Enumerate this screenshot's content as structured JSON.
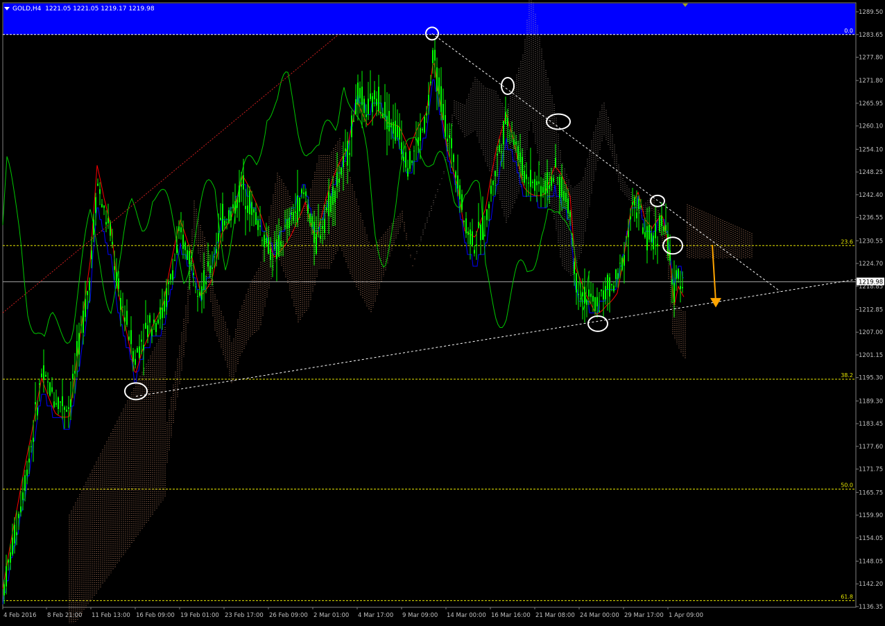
{
  "header": {
    "symbol": "GOLD,H4",
    "quote": "1221.05 1221.05 1219.17 1219.98"
  },
  "colors": {
    "background": "#000000",
    "candles": "#00ff00",
    "tenkan": "#ff0000",
    "kijun": "#0000ff",
    "chikou": "#00c800",
    "kumo": "#ffb38a",
    "fib_zone": "#0000ff",
    "fib_lines": "#e6e600",
    "trendlines": "#ffffff",
    "arrow": "#ffa500",
    "axis_text": "#c0c0c0"
  },
  "chart_data": {
    "type": "candlestick",
    "title": "",
    "price_ticks": [
      "1289.50",
      "1283.65",
      "1277.80",
      "1271.80",
      "1265.95",
      "1260.10",
      "1254.10",
      "1248.25",
      "1242.40",
      "1236.55",
      "1230.55",
      "1224.70",
      "1218.85",
      "1212.85",
      "1207.00",
      "1201.15",
      "1195.30",
      "1189.30",
      "1183.45",
      "1177.60",
      "1171.75",
      "1165.75",
      "1159.90",
      "1154.05",
      "1148.05",
      "1142.20",
      "1136.35"
    ],
    "time_ticks": [
      "4 Feb 2016",
      "8 Feb 21:00",
      "11 Feb 13:00",
      "16 Feb 09:00",
      "19 Feb 01:00",
      "23 Feb 17:00",
      "26 Feb 09:00",
      "2 Mar 01:00",
      "4 Mar 17:00",
      "9 Mar 09:00",
      "14 Mar 00:00",
      "16 Mar 16:00",
      "21 Mar 08:00",
      "24 Mar 00:00",
      "29 Mar 17:00",
      "1 Apr 09:00"
    ],
    "current_price": "1219.98",
    "ylim": [
      1136.35,
      1289.5
    ],
    "fibonacci": [
      {
        "label": "0.0",
        "price": 1283.65
      },
      {
        "label": "23.6",
        "price": 1229.3
      },
      {
        "label": "38.2",
        "price": 1194.9
      },
      {
        "label": "50.0",
        "price": 1166.6
      },
      {
        "label": "61.8",
        "price": 1137.9
      }
    ],
    "swing_points": [
      {
        "time": "9 Mar 09:00",
        "price": 1283.9
      },
      {
        "time": "16 Mar 16:00",
        "price": 1270.4
      },
      {
        "time": "21 Mar 08:00",
        "price": 1261.2
      },
      {
        "time": "29 Mar 17:00",
        "price": 1240.8
      },
      {
        "time": "1 Apr 09:00",
        "price": 1229.3
      },
      {
        "time": "24 Mar 00:00",
        "price": 1209.2
      },
      {
        "time": "16 Feb 09:00",
        "price": 1191.8
      }
    ],
    "annotations": [
      "descending resistance trendline",
      "ascending support trendline",
      "orange arrow pointing down"
    ]
  }
}
